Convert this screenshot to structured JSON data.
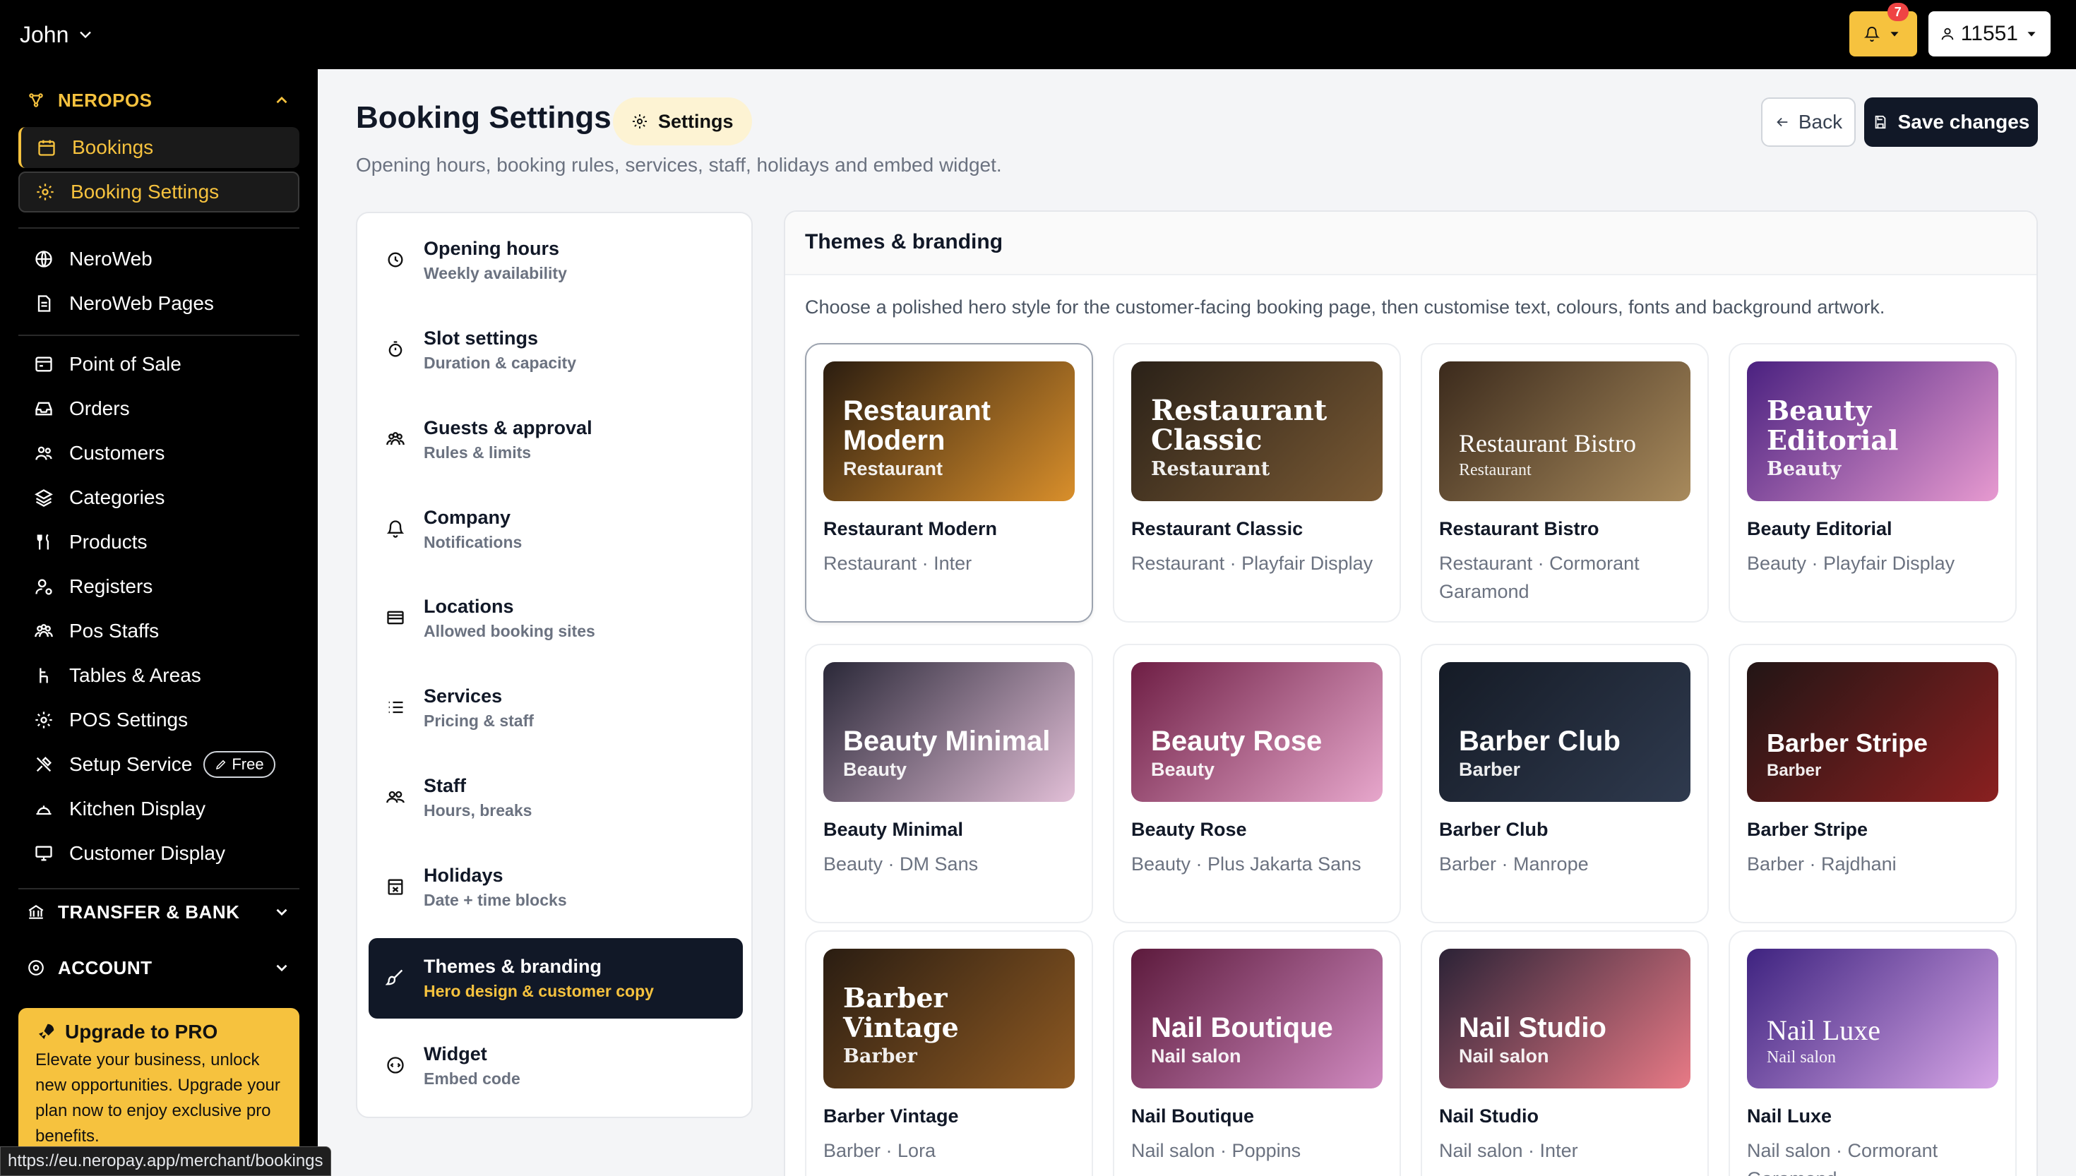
{
  "topbar": {
    "user": "John",
    "notification_count": "7",
    "account_id": "11551"
  },
  "sidebar": {
    "brand": "NEROPOS",
    "items": [
      {
        "label": "Bookings",
        "icon": "calendar-icon"
      },
      {
        "label": "Booking Settings",
        "icon": "gear-icon"
      },
      {
        "label": "NeroWeb",
        "icon": "globe-icon"
      },
      {
        "label": "NeroWeb Pages",
        "icon": "document-icon"
      },
      {
        "label": "Point of Sale",
        "icon": "pos-icon"
      },
      {
        "label": "Orders",
        "icon": "inbox-icon"
      },
      {
        "label": "Customers",
        "icon": "users-icon"
      },
      {
        "label": "Categories",
        "icon": "layers-icon"
      },
      {
        "label": "Products",
        "icon": "utensils-icon"
      },
      {
        "label": "Registers",
        "icon": "user-cog-icon"
      },
      {
        "label": "Pos Staffs",
        "icon": "staff-icon"
      },
      {
        "label": "Tables & Areas",
        "icon": "chair-icon"
      },
      {
        "label": "POS Settings",
        "icon": "gear-icon"
      },
      {
        "label": "Setup Service",
        "icon": "tools-icon"
      },
      {
        "label": "Kitchen Display",
        "icon": "cloche-icon"
      },
      {
        "label": "Customer Display",
        "icon": "monitor-icon"
      }
    ],
    "free_badge": "Free",
    "transfer_section": "TRANSFER & BANK",
    "account_section": "ACCOUNT",
    "promo": {
      "title": "Upgrade to PRO",
      "text": "Elevate your business, unlock new opportunities. Upgrade your plan now to enjoy exclusive pro benefits."
    }
  },
  "status_url": "https://eu.neropay.app/merchant/bookings",
  "header": {
    "title": "Booking Settings",
    "chip": "Settings",
    "subtitle": "Opening hours, booking rules, services, staff, holidays and embed widget.",
    "back": "Back",
    "save": "Save changes"
  },
  "menu": [
    {
      "title": "Opening hours",
      "sub": "Weekly availability",
      "icon": "clock-icon"
    },
    {
      "title": "Slot settings",
      "sub": "Duration & capacity",
      "icon": "stopwatch-icon"
    },
    {
      "title": "Guests & approval",
      "sub": "Rules & limits",
      "icon": "users-icon"
    },
    {
      "title": "Company",
      "sub": "Notifications",
      "icon": "bell-icon"
    },
    {
      "title": "Locations",
      "sub": "Allowed booking sites",
      "icon": "store-icon"
    },
    {
      "title": "Services",
      "sub": "Pricing & staff",
      "icon": "list-icon"
    },
    {
      "title": "Staff",
      "sub": "Hours, breaks",
      "icon": "staff-icon"
    },
    {
      "title": "Holidays",
      "sub": "Date + time blocks",
      "icon": "calendar-x-icon"
    },
    {
      "title": "Themes & branding",
      "sub": "Hero design & customer copy",
      "icon": "brush-icon"
    },
    {
      "title": "Widget",
      "sub": "Embed code",
      "icon": "code-icon"
    }
  ],
  "panel": {
    "title": "Themes & branding",
    "description": "Choose a polished hero style for the customer-facing booking page, then customise text, colours, fonts and background artwork."
  },
  "themes": [
    {
      "name": "Restaurant Modern",
      "category": "Restaurant",
      "meta": "Restaurant · Inter",
      "gradient": [
        "#2b1d10",
        "#d98f2b"
      ],
      "selected": true
    },
    {
      "name": "Restaurant Classic",
      "category": "Restaurant",
      "meta": "Restaurant · Playfair Display",
      "gradient": [
        "#2a2118",
        "#7a5a34"
      ]
    },
    {
      "name": "Restaurant Bistro",
      "category": "Restaurant",
      "meta": "Restaurant · Cormorant Garamond",
      "gradient": [
        "#3b2a1c",
        "#a88a5c"
      ]
    },
    {
      "name": "Beauty Editorial",
      "category": "Beauty",
      "meta": "Beauty · Playfair Display",
      "gradient": [
        "#4a2180",
        "#e79ad0"
      ]
    },
    {
      "name": "Beauty Minimal",
      "category": "Beauty",
      "meta": "Beauty · DM Sans",
      "gradient": [
        "#2a2838",
        "#e2bfd7"
      ]
    },
    {
      "name": "Beauty Rose",
      "category": "Beauty",
      "meta": "Beauty · Plus Jakarta Sans",
      "gradient": [
        "#6e1e44",
        "#e7a7cc"
      ]
    },
    {
      "name": "Barber Club",
      "category": "Barber",
      "meta": "Barber · Manrope",
      "gradient": [
        "#151b26",
        "#2f3a4e"
      ]
    },
    {
      "name": "Barber Stripe",
      "category": "Barber",
      "meta": "Barber · Rajdhani",
      "gradient": [
        "#221515",
        "#8a2020"
      ]
    },
    {
      "name": "Barber Vintage",
      "category": "Barber",
      "meta": "Barber · Lora",
      "gradient": [
        "#2a1d12",
        "#8f5a22"
      ]
    },
    {
      "name": "Nail Boutique",
      "category": "Nail salon",
      "meta": "Nail salon · Poppins",
      "gradient": [
        "#5c1a3c",
        "#d08ac0"
      ]
    },
    {
      "name": "Nail Studio",
      "category": "Nail salon",
      "meta": "Nail salon · Inter",
      "gradient": [
        "#2b2236",
        "#e87a86"
      ]
    },
    {
      "name": "Nail Luxe",
      "category": "Nail salon",
      "meta": "Nail salon · Cormorant Garamond",
      "gradient": [
        "#3e2380",
        "#d6a5e6"
      ]
    }
  ]
}
